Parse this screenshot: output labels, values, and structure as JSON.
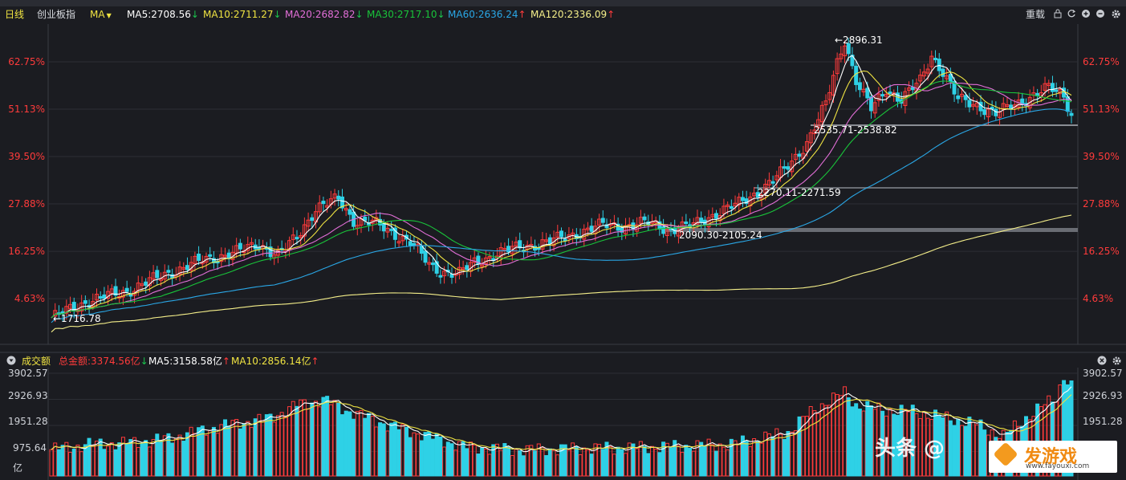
{
  "toolbar": {
    "period": "日线",
    "index_name": "创业板指",
    "indicator": "MA",
    "ma": [
      {
        "label": "MA5:2708.56",
        "dir": "down",
        "color": "#ffffff"
      },
      {
        "label": "MA10:2711.27",
        "dir": "down",
        "color": "#f0e442"
      },
      {
        "label": "MA20:2682.82",
        "dir": "down",
        "color": "#e36fd8"
      },
      {
        "label": "MA30:2717.10",
        "dir": "down",
        "color": "#19c43a"
      },
      {
        "label": "MA60:2636.24",
        "dir": "up",
        "color": "#2aa7e6"
      },
      {
        "label": "MA120:2336.09",
        "dir": "up",
        "color": "#f5ef8a"
      }
    ],
    "reload_label": "重载",
    "arrow_down": "↓",
    "arrow_up": "↑"
  },
  "price_axis": {
    "ticks": [
      "62.75%",
      "51.13%",
      "39.50%",
      "27.88%",
      "16.25%",
      "4.63%"
    ]
  },
  "annotations": {
    "high": "←2896.31",
    "low": "←1716.78",
    "gap1": "2535.71-2538.82",
    "gap2": "2270.11-2271.59",
    "gap3": "2090.30-2105.24"
  },
  "volume": {
    "title": "成交额",
    "total_label": "总金额:3374.56亿",
    "ma5_label": "MA5:3158.58亿",
    "ma10_label": "MA10:2856.14亿",
    "axis": [
      "3902.57",
      "2926.93",
      "1951.28",
      "975.64"
    ],
    "unit": "亿"
  },
  "watermark": {
    "text": "头条 @",
    "logo": "发游戏",
    "logo_url": "www.fayouxi.com"
  },
  "colors": {
    "up": "#ff3b3b",
    "down": "#2ed1e6",
    "ma5": "#ffffff",
    "ma10": "#f0e442",
    "ma20": "#e36fd8",
    "ma30": "#19c43a",
    "ma60": "#2aa7e6",
    "ma120": "#f5ef8a"
  },
  "chart_data": {
    "type": "candlestick",
    "title": "创业板指",
    "period": "日线",
    "y_axis_ticks_percent": [
      62.75,
      51.13,
      39.5,
      27.88,
      16.25,
      4.63
    ],
    "low": 1716.78,
    "high": 2896.31,
    "close_anchors": [
      [
        0,
        1716.78
      ],
      [
        10,
        1790
      ],
      [
        20,
        1830
      ],
      [
        30,
        1900
      ],
      [
        40,
        1960
      ],
      [
        50,
        2000
      ],
      [
        55,
        2030
      ],
      [
        60,
        1980
      ],
      [
        65,
        2060
      ],
      [
        70,
        2180
      ],
      [
        76,
        2220
      ],
      [
        80,
        2130
      ],
      [
        85,
        2120
      ],
      [
        90,
        2080
      ],
      [
        95,
        2040
      ],
      [
        100,
        1940
      ],
      [
        103,
        1915
      ],
      [
        108,
        1905
      ],
      [
        112,
        1950
      ],
      [
        118,
        1990
      ],
      [
        125,
        2020
      ],
      [
        132,
        2040
      ],
      [
        140,
        2080
      ],
      [
        146,
        2110
      ],
      [
        152,
        2105
      ],
      [
        158,
        2120
      ],
      [
        164,
        2090
      ],
      [
        170,
        2110
      ],
      [
        176,
        2160
      ],
      [
        182,
        2200
      ],
      [
        188,
        2260
      ],
      [
        194,
        2340
      ],
      [
        200,
        2460
      ],
      [
        205,
        2620
      ],
      [
        208,
        2800
      ],
      [
        210,
        2896.31
      ],
      [
        213,
        2720
      ],
      [
        217,
        2600
      ],
      [
        221,
        2690
      ],
      [
        225,
        2640
      ],
      [
        230,
        2720
      ],
      [
        233,
        2830
      ],
      [
        236,
        2760
      ],
      [
        240,
        2640
      ],
      [
        245,
        2620
      ],
      [
        250,
        2580
      ],
      [
        255,
        2620
      ],
      [
        260,
        2660
      ],
      [
        264,
        2690
      ],
      [
        268,
        2660
      ],
      [
        270,
        2580
      ]
    ],
    "gaps": [
      {
        "from": 2535.71,
        "to": 2538.82
      },
      {
        "from": 2270.11,
        "to": 2271.59
      },
      {
        "from": 2090.3,
        "to": 2105.24
      }
    ],
    "series": [
      {
        "name": "MA5",
        "last": 2708.56
      },
      {
        "name": "MA10",
        "last": 2711.27
      },
      {
        "name": "MA20",
        "last": 2682.82
      },
      {
        "name": "MA30",
        "last": 2717.1
      },
      {
        "name": "MA60",
        "last": 2636.24
      },
      {
        "name": "MA120",
        "last": 2336.09
      }
    ],
    "volume": {
      "unit": "亿",
      "ticks": [
        975.64,
        1951.28,
        2926.93,
        3902.57
      ],
      "total": 3374.56,
      "ma5": 3158.58,
      "ma10": 2856.14,
      "anchors": [
        [
          0,
          1000
        ],
        [
          10,
          1200
        ],
        [
          20,
          1250
        ],
        [
          30,
          1400
        ],
        [
          45,
          1900
        ],
        [
          58,
          2200
        ],
        [
          65,
          2700
        ],
        [
          72,
          2900
        ],
        [
          78,
          2500
        ],
        [
          90,
          1900
        ],
        [
          100,
          1500
        ],
        [
          110,
          1100
        ],
        [
          125,
          1000
        ],
        [
          140,
          1050
        ],
        [
          160,
          1100
        ],
        [
          180,
          1200
        ],
        [
          195,
          1650
        ],
        [
          200,
          2300
        ],
        [
          205,
          2800
        ],
        [
          210,
          3150
        ],
        [
          213,
          2700
        ],
        [
          220,
          2500
        ],
        [
          228,
          2450
        ],
        [
          235,
          2250
        ],
        [
          245,
          1950
        ],
        [
          252,
          1500
        ],
        [
          258,
          2200
        ],
        [
          262,
          2600
        ],
        [
          266,
          3000
        ],
        [
          268,
          3800
        ],
        [
          270,
          3374.56
        ]
      ]
    }
  }
}
